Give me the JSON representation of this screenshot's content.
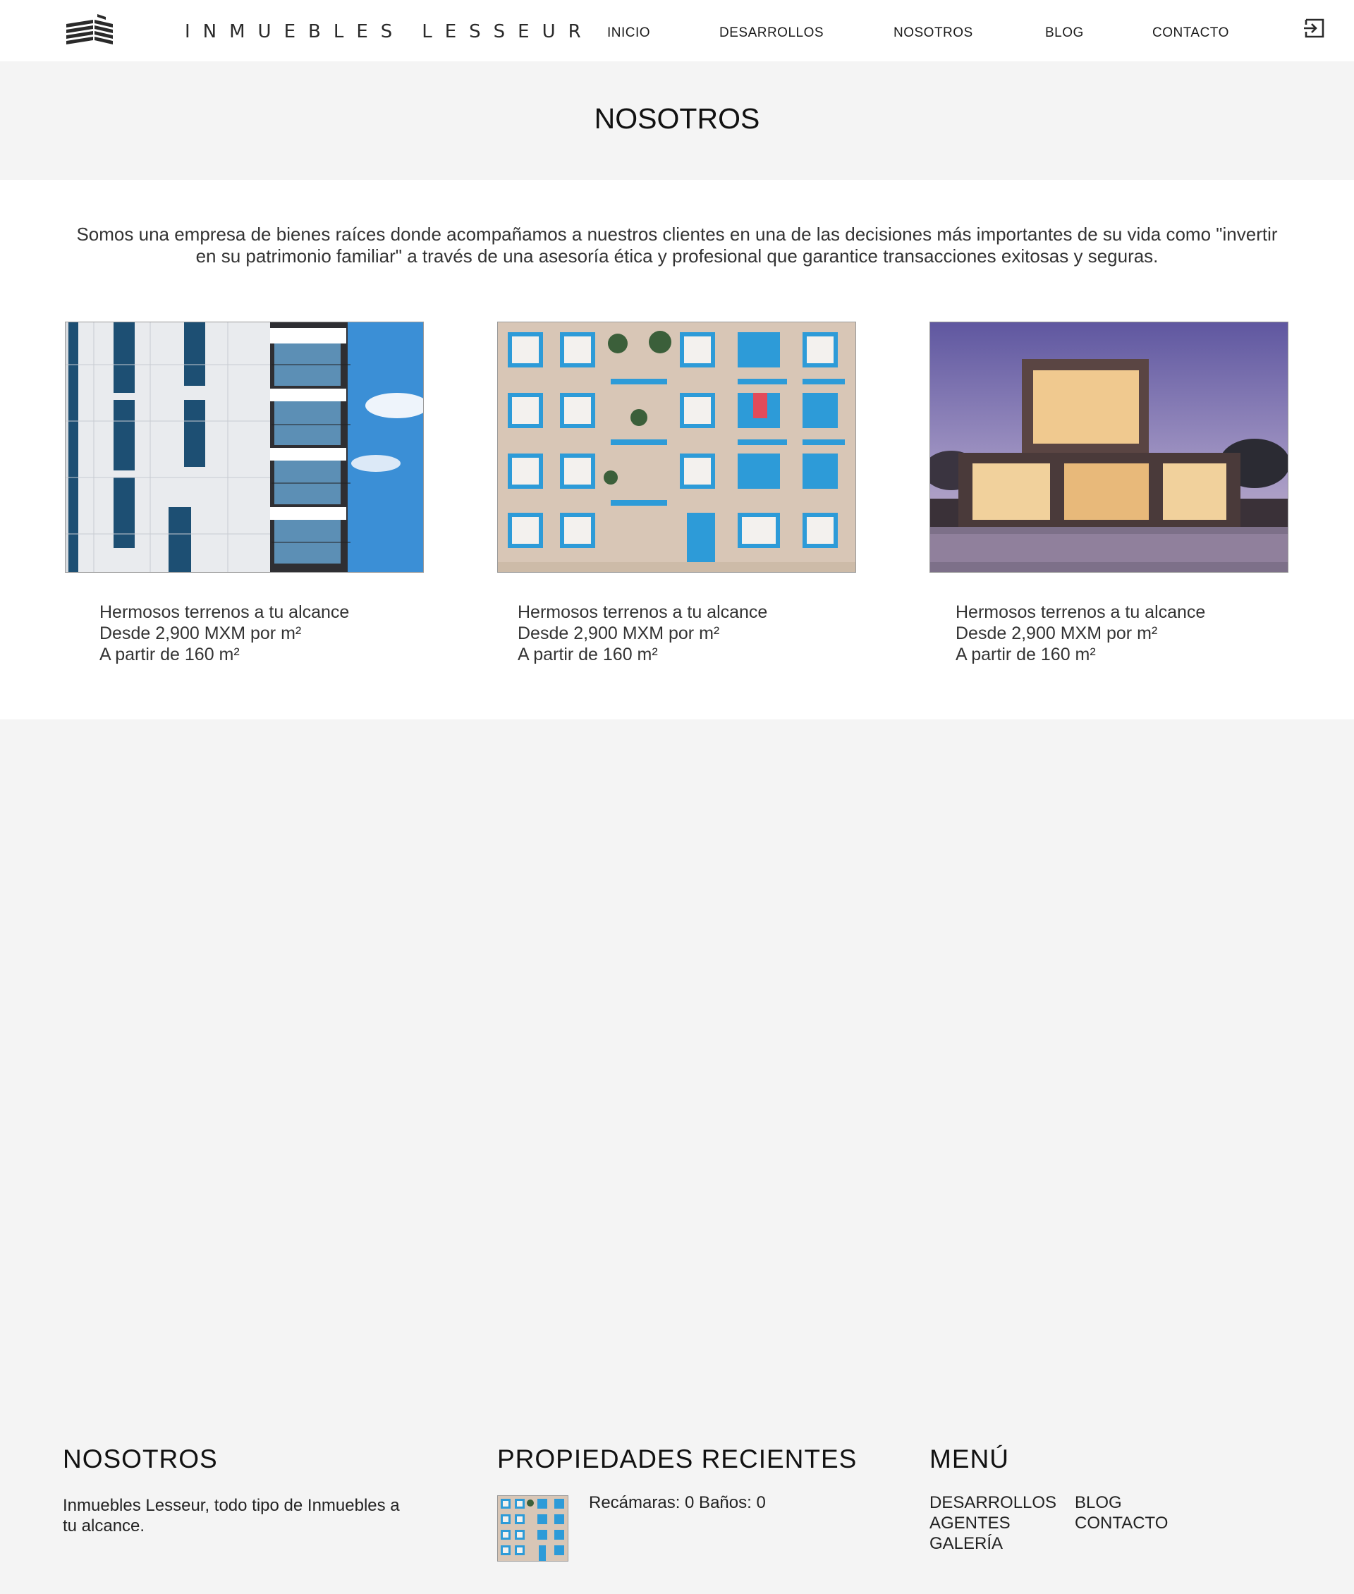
{
  "header": {
    "brand": {
      "word1": "INMUEBLES",
      "word2": "LESSEUR"
    },
    "nav": [
      "INICIO",
      "DESARROLLOS",
      "NOSOTROS",
      "BLOG",
      "CONTACTO"
    ],
    "login_icon": "login-icon"
  },
  "page": {
    "title": "NOSOTROS"
  },
  "intro": "Somos una empresa de bienes raíces donde acompañamos a nuestros clientes en una de las decisiones más importantes de su vida como \"invertir en su patrimonio familiar\" a través de una asesoría ética y profesional que garantice transacciones exitosas y seguras.",
  "cards": [
    {
      "image": "white building with blue balconies",
      "line1": "Hermosos terrenos a tu alcance",
      "line2": "Desde 2,900 MXM por m²",
      "line3": "A partir de 160 m²"
    },
    {
      "image": "apartment facade with blue windows and plants",
      "line1": "Hermosos terrenos a tu alcance",
      "line2": "Desde 2,900 MXM por m²",
      "line3": "A partir de 160 m²"
    },
    {
      "image": "modern house with pool at dusk",
      "line1": "Hermosos terrenos a tu alcance",
      "line2": "Desde 2,900 MXM por m²",
      "line3": "A partir de 160 m²"
    }
  ],
  "footer": {
    "about": {
      "heading": "NOSOTROS",
      "text": "Inmuebles Lesseur, todo tipo de Inmuebles a tu alcance."
    },
    "recent": {
      "heading": "PROPIEDADES RECIENTES",
      "item_text": "Recámaras: 0 Baños: 0"
    },
    "menu": {
      "heading": "MENÚ",
      "col1": [
        "DESARROLLOS",
        "AGENTES",
        "GALERÍA"
      ],
      "col2": [
        "BLOG",
        "CONTACTO"
      ]
    }
  },
  "colors": {
    "band_gray": "#f4f4f4",
    "text_dark": "#333333",
    "accent_blue": "#2d9bd8"
  }
}
